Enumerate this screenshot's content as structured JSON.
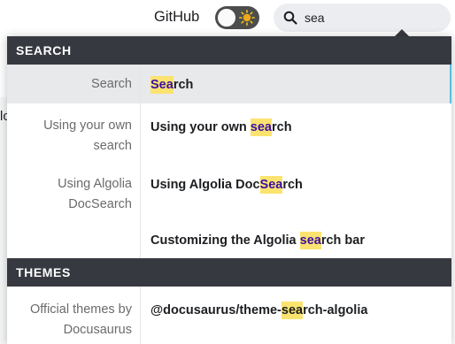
{
  "navbar": {
    "github_label": "GitHub",
    "theme_toggle_icon": "sun-icon",
    "search": {
      "value": "sea",
      "icon": "search-icon"
    }
  },
  "page_fragments": {
    "left_edge_text": "lc"
  },
  "dropdown": {
    "highlight_color": "#fbe36f",
    "header_color": "#373940",
    "sections": [
      {
        "title": "SEARCH",
        "items": [
          {
            "category": "Search",
            "pre": "",
            "match": "Sea",
            "post": "rch",
            "active": true
          },
          {
            "category": "Using your own search",
            "pre": "Using your own ",
            "match": "sea",
            "post": "rch"
          },
          {
            "category": "Using Algolia DocSearch",
            "pre": "Using Algolia Doc",
            "match": "Sea",
            "post": "rch"
          },
          {
            "category": "",
            "pre": "Customizing the Algolia ",
            "match": "sea",
            "post": "rch bar"
          }
        ]
      },
      {
        "title": "THEMES",
        "items": [
          {
            "category": "Official themes by Docusaurus",
            "pre": "@docusaurus/theme-",
            "match": "sea",
            "post": "rch-algolia"
          }
        ]
      }
    ]
  }
}
